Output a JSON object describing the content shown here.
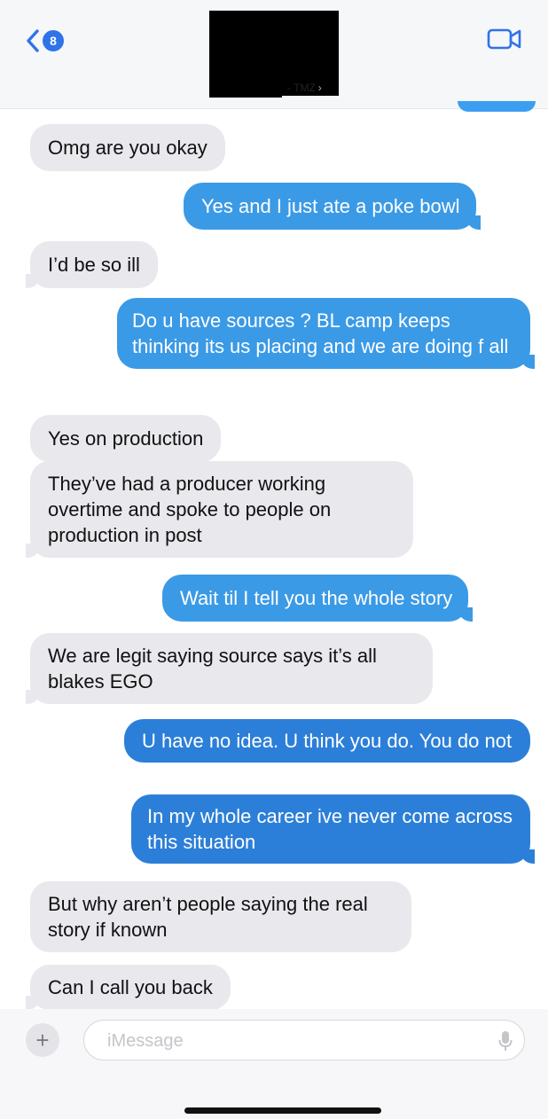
{
  "header": {
    "back_badge": "8",
    "contact_name": "- TMZ",
    "contact_chevron": "›",
    "icons": {
      "back": "chevron-left-icon",
      "video": "video-camera-icon"
    },
    "accent_color": "#2f73e8"
  },
  "messages": [
    {
      "side": "in",
      "text": "Omg are you okay"
    },
    {
      "side": "out",
      "text": "Yes and I just ate a poke bowl"
    },
    {
      "side": "in",
      "text": "I’d be so ill"
    },
    {
      "side": "out",
      "text": "Do u have sources ? BL camp keeps thinking its us placing and we are doing f all"
    },
    {
      "side": "in",
      "text": "Yes on production"
    },
    {
      "side": "in",
      "text": "They’ve had a producer working overtime and spoke to people on production in post"
    },
    {
      "side": "out",
      "text": "Wait til I tell you the whole story"
    },
    {
      "side": "in",
      "text": "We are legit saying source says it’s all blakes EGO"
    },
    {
      "side": "out",
      "text": "U have no idea. U think you do. You do not"
    },
    {
      "side": "out",
      "text": "In my whole career ive never come across this situation"
    },
    {
      "side": "in",
      "text": "But why aren’t people saying the real story if known"
    },
    {
      "side": "in",
      "text": "Can I call you back"
    }
  ],
  "composer": {
    "plus_label": "+",
    "placeholder": "iMessage",
    "icons": {
      "plus": "plus-icon",
      "mic": "microphone-icon"
    }
  },
  "colors": {
    "incoming_bubble": "#e8e8ed",
    "outgoing_bubble": "#3b9ae6"
  }
}
